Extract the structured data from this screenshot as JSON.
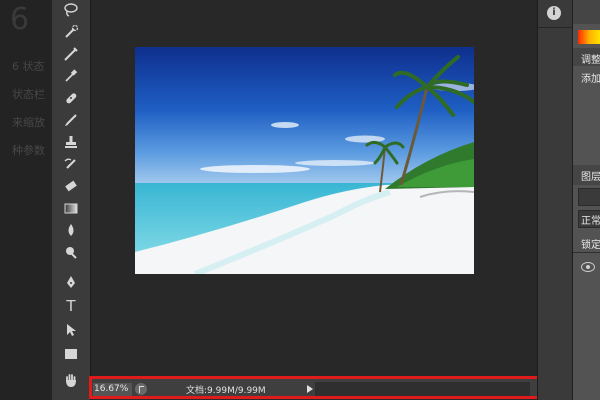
{
  "background_page": {
    "heading": "6",
    "lines": [
      "6 状态",
      "状态栏",
      "来缩放",
      "种参数"
    ]
  },
  "tools": [
    {
      "name": "lasso-tool-icon",
      "glyph": "lasso"
    },
    {
      "name": "quick-selection-tool-icon",
      "glyph": "qsel"
    },
    {
      "name": "crop-tool-icon",
      "glyph": "crop"
    },
    {
      "name": "eyedropper-tool-icon",
      "glyph": "eyedrop"
    },
    {
      "name": "healing-brush-tool-icon",
      "glyph": "heal"
    },
    {
      "name": "brush-tool-icon",
      "glyph": "brush"
    },
    {
      "name": "clone-stamp-tool-icon",
      "glyph": "stamp"
    },
    {
      "name": "history-brush-tool-icon",
      "glyph": "hbrush"
    },
    {
      "name": "eraser-tool-icon",
      "glyph": "eraser"
    },
    {
      "name": "gradient-tool-icon",
      "glyph": "gradient"
    },
    {
      "name": "blur-tool-icon",
      "glyph": "blur"
    },
    {
      "name": "dodge-tool-icon",
      "glyph": "dodge"
    },
    {
      "name": "pen-tool-icon",
      "glyph": "pen"
    },
    {
      "name": "type-tool-icon",
      "glyph": "T"
    },
    {
      "name": "path-selection-tool-icon",
      "glyph": "arrow"
    },
    {
      "name": "rectangle-tool-icon",
      "glyph": "rect"
    },
    {
      "name": "hand-tool-icon",
      "glyph": "hand"
    }
  ],
  "status_bar": {
    "zoom": "16.67%",
    "doc_info": "文档:9.99M/9.99M",
    "highlight_color": "#e01b1b"
  },
  "right_panel": {
    "info_icon": "i",
    "adjustments_label": "调整",
    "add_label": "添加",
    "layers_label": "图层",
    "blend_mode": "正常",
    "lock_label": "锁定"
  },
  "colors": {
    "canvas_bg": "#282828",
    "panel_bg": "#3b3b3b",
    "highlight": "#e01b1b"
  }
}
